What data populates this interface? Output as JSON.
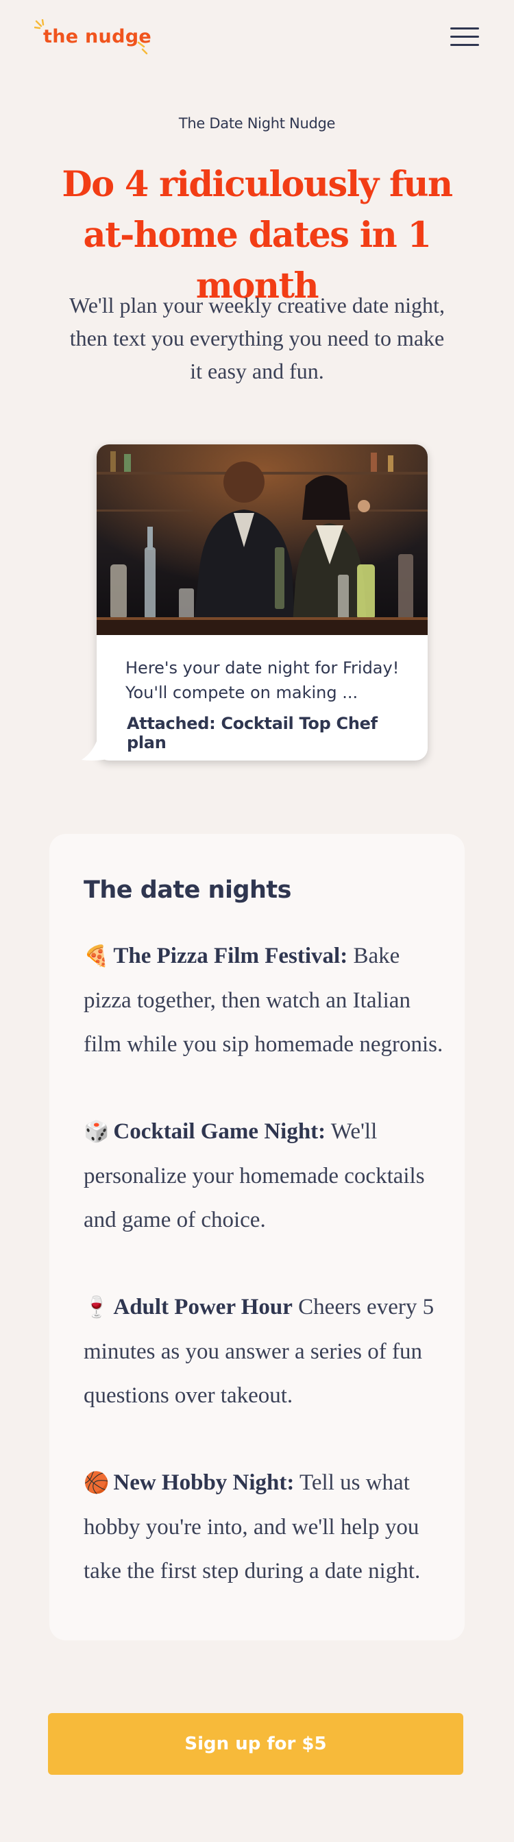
{
  "header": {
    "logo_text": "the nudge",
    "logo_color": "#f0541d",
    "menu_icon": "hamburger-menu-icon"
  },
  "hero": {
    "eyebrow": "The Date Night Nudge",
    "headline": "Do 4 ridiculously fun at-home dates in 1 month",
    "subhead": "We'll plan your weekly creative date night, then text you everything you need to make it easy and fun.",
    "headline_color": "#f23d15"
  },
  "message_card": {
    "message": "Here's your date night for Friday! You'll compete on making ...",
    "attachment": "Attached: Cocktail Top Chef plan"
  },
  "date_nights": {
    "title": "The date nights",
    "items": [
      {
        "emoji": "🍕",
        "icon": "pizza-icon",
        "name": "The Pizza Film Festival:",
        "description": " Bake pizza together, then watch an Italian film while you sip homemade negronis."
      },
      {
        "emoji": "🎲",
        "icon": "dice-icon",
        "name": "Cocktail Game Night:",
        "description": " We'll personalize your homemade cocktails and game of choice."
      },
      {
        "emoji": "🍷",
        "icon": "wine-glass-icon",
        "name": "Adult Power Hour",
        "description": " Cheers every 5 minutes as you answer a series of fun questions over takeout."
      },
      {
        "emoji": "🏀",
        "icon": "basketball-icon",
        "name": "New Hobby Night:",
        "description": " Tell us what hobby you're into, and we'll help you take the first step during a date night."
      }
    ]
  },
  "cta": {
    "label": "Sign up for $5",
    "color": "#f7ba3a"
  }
}
